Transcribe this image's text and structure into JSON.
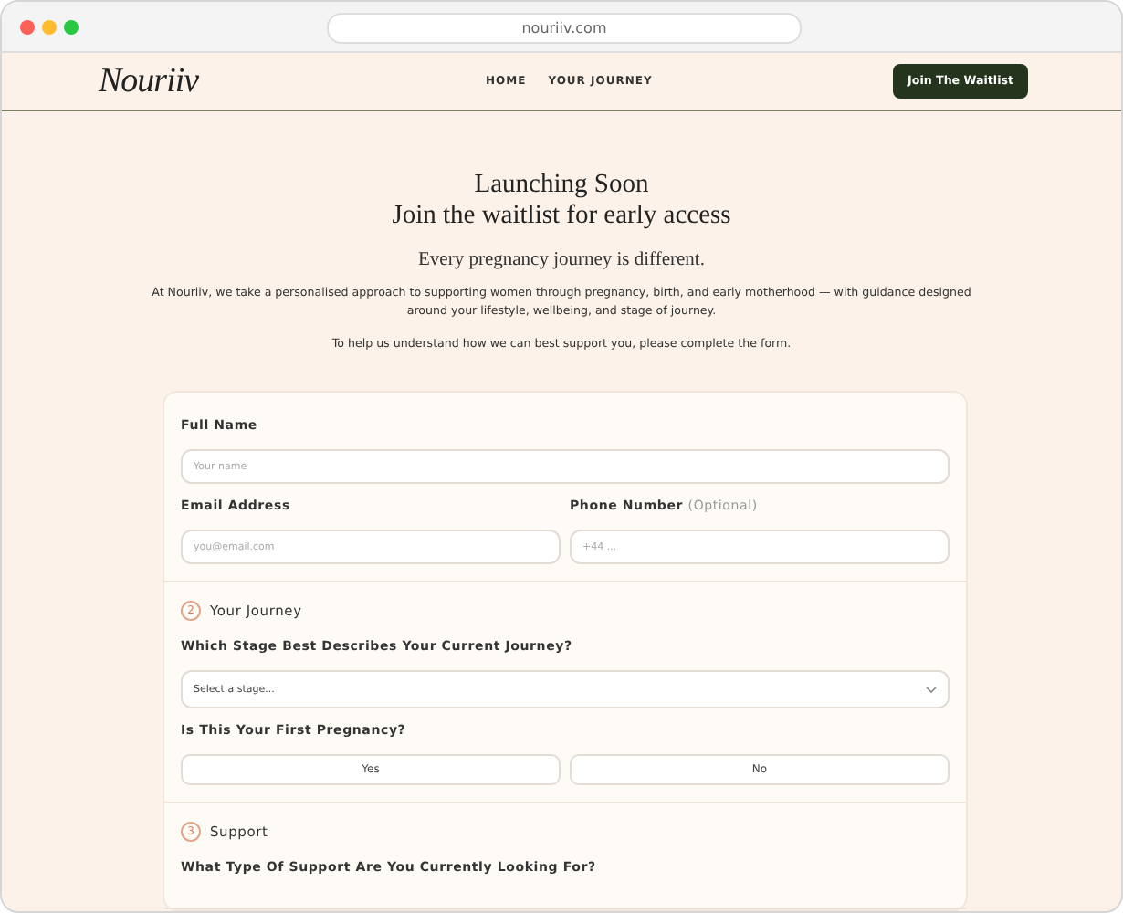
{
  "browser": {
    "url": "nouriiv.com"
  },
  "header": {
    "logo": "Nouriiv",
    "nav": [
      "HOME",
      "YOUR JOURNEY"
    ],
    "cta": "Join The Waitlist"
  },
  "hero": {
    "title_lines": [
      "Launching Soon",
      "Join the waitlist for early access"
    ],
    "subtitle": "Every pregnancy journey is different.",
    "paragraphs": [
      "At Nouriiv, we take a personalised approach to supporting women through pregnancy, birth, and early motherhood — with guidance designed around your lifestyle, wellbeing, and stage of journey.",
      "To help us understand how we can best support you, please complete the form."
    ]
  },
  "form": {
    "full_name": {
      "label": "Full Name",
      "placeholder": "Your name"
    },
    "email": {
      "label": "Email Address",
      "placeholder": "you@email.com"
    },
    "phone": {
      "label": "Phone Number",
      "optional": "(Optional)",
      "placeholder": "+44 ..."
    },
    "sections": [
      {
        "number": "2",
        "title": "Your Journey",
        "stage_label": "Which Stage Best Describes Your Current Journey?",
        "stage_placeholder": "Select a stage...",
        "first_label": "Is This Your First Pregnancy?",
        "choices": [
          {
            "label": "Yes",
            "selected": false
          },
          {
            "label": "No",
            "selected": false
          }
        ]
      },
      {
        "number": "3",
        "title": "Support",
        "question": "What Type Of Support Are You Currently Looking For?"
      }
    ]
  }
}
